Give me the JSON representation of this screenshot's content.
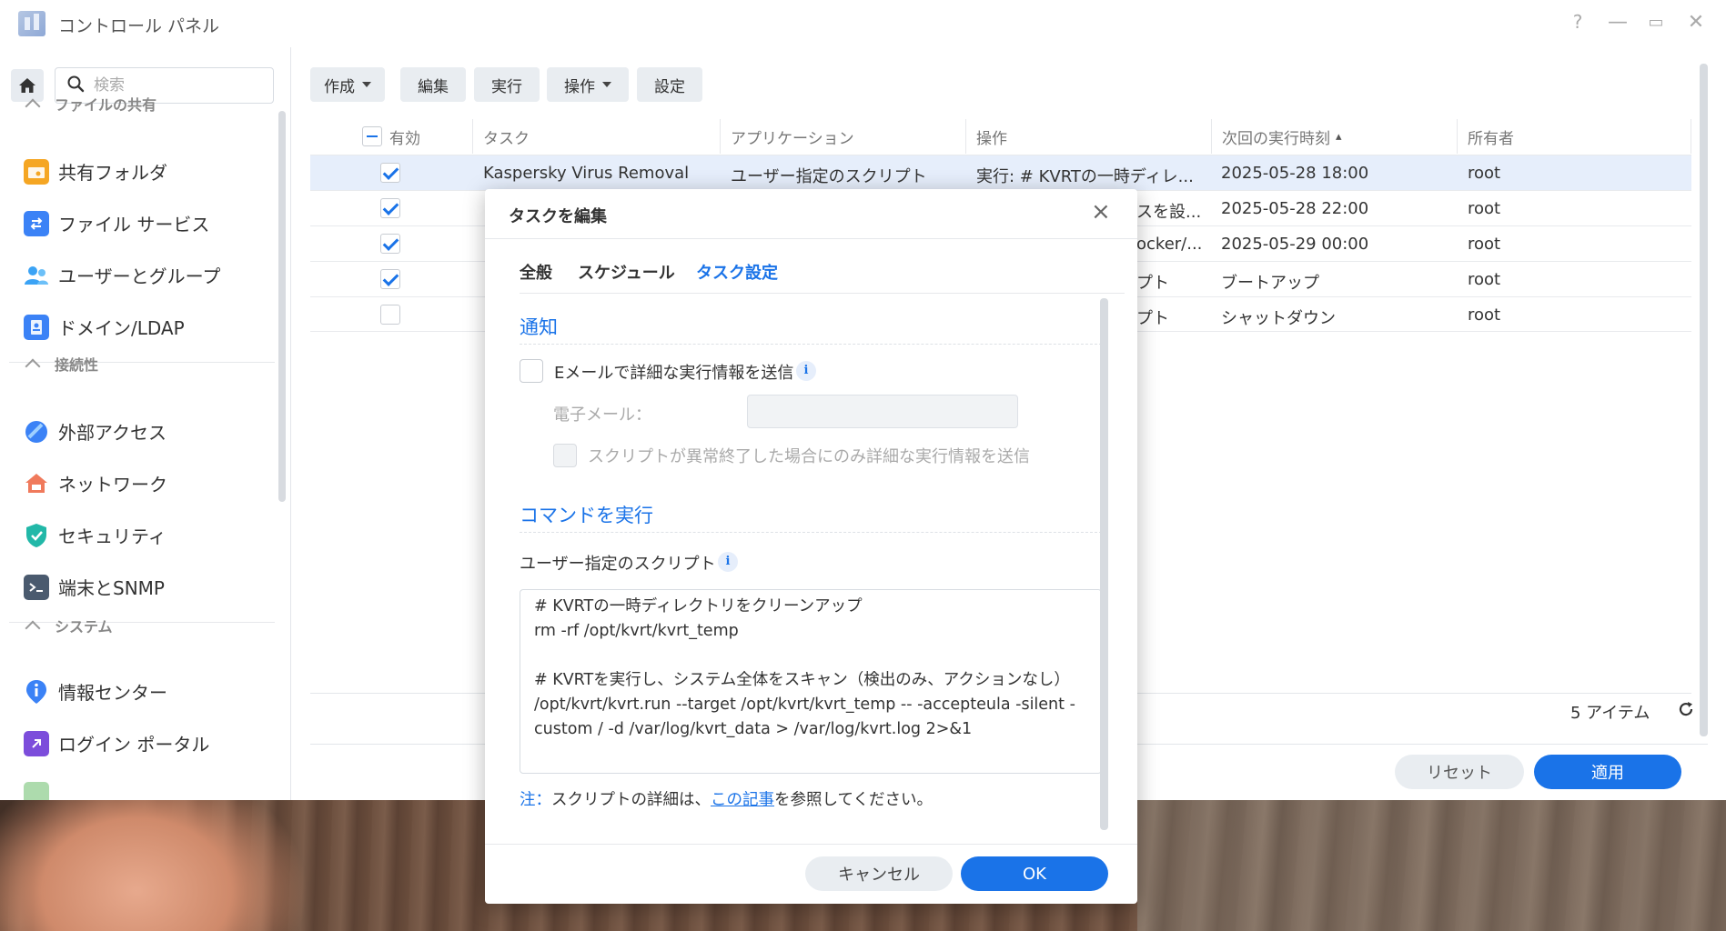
{
  "window": {
    "title": "コントロール パネル",
    "controls": {
      "help": "?",
      "minimize": "—",
      "maximize": "▭",
      "close": "✕"
    }
  },
  "sidebar": {
    "search_placeholder": "検索",
    "sections": [
      {
        "title": "ファイルの共有",
        "items": [
          {
            "label": "共有フォルダ",
            "icon": "shared-folder-icon",
            "color": "#f5a623"
          },
          {
            "label": "ファイル サービス",
            "icon": "file-services-icon",
            "color": "#3b82f6"
          },
          {
            "label": "ユーザーとグループ",
            "icon": "users-icon",
            "color": "#3ba3f5"
          },
          {
            "label": "ドメイン/LDAP",
            "icon": "domain-icon",
            "color": "#3b82f6"
          }
        ]
      },
      {
        "title": "接続性",
        "items": [
          {
            "label": "外部アクセス",
            "icon": "external-access-icon",
            "color": "#3b82f6"
          },
          {
            "label": "ネットワーク",
            "icon": "network-icon",
            "color": "#f07a5c"
          },
          {
            "label": "セキュリティ",
            "icon": "security-icon",
            "color": "#22b8a8"
          },
          {
            "label": "端末とSNMP",
            "icon": "terminal-icon",
            "color": "#4a5a6e"
          }
        ]
      },
      {
        "title": "システム",
        "items": [
          {
            "label": "情報センター",
            "icon": "info-center-icon",
            "color": "#3b82f6"
          },
          {
            "label": "ログイン ポータル",
            "icon": "login-portal-icon",
            "color": "#7c4ddb"
          }
        ]
      }
    ]
  },
  "toolbar": {
    "create": "作成",
    "edit": "編集",
    "run": "実行",
    "action": "操作",
    "settings": "設定"
  },
  "table": {
    "columns": [
      "有効",
      "タスク",
      "アプリケーション",
      "操作",
      "次回の実行時刻",
      "所有者"
    ],
    "sort_indicator": "▴",
    "rows": [
      {
        "enabled": true,
        "task": "Kaspersky Virus Removal",
        "app": "ユーザー指定のスクリプト",
        "op": "実行: # KVRTの一時ディレ...",
        "next": "2025-05-28 18:00",
        "owner": "root",
        "selected": true
      },
      {
        "enabled": true,
        "task": "",
        "app": "",
        "op": "スを設...",
        "next": "2025-05-28 22:00",
        "owner": "root"
      },
      {
        "enabled": true,
        "task": "",
        "app": "",
        "op": "ocker/...",
        "next": "2025-05-29 00:00",
        "owner": "root"
      },
      {
        "enabled": true,
        "task": "",
        "app": "",
        "op": "プト",
        "next": "ブートアップ",
        "owner": "root"
      },
      {
        "enabled": false,
        "task": "",
        "app": "",
        "op": "プト",
        "next": "シャットダウン",
        "owner": "root"
      }
    ],
    "item_count": "5 アイテム"
  },
  "footer": {
    "reset": "リセット",
    "apply": "適用"
  },
  "dialog": {
    "title": "タスクを編集",
    "tabs": [
      "全般",
      "スケジュール",
      "タスク設定"
    ],
    "active_tab": "タスク設定",
    "notify_section": "通知",
    "email_checkbox_label": "Eメールで詳細な実行情報を送信",
    "email_label": "電子メール：",
    "email_value": "",
    "abnormal_only_label": "スクリプトが異常終了した場合にのみ詳細な実行情報を送信",
    "command_section": "コマンドを実行",
    "script_label": "ユーザー指定のスクリプト",
    "script": "# KVRTの一時ディレクトリをクリーンアップ\nrm -rf /opt/kvrt/kvrt_temp\n\n# KVRTを実行し、システム全体をスキャン（検出のみ、アクションなし）\n/opt/kvrt/kvrt.run --target /opt/kvrt/kvrt_temp -- -accepteula -silent -custom / -d /var/log/kvrt_data > /var/log/kvrt.log 2>&1",
    "note_prefix": "注：",
    "note_text_1": "スクリプトの詳細は、",
    "note_link": "この記事",
    "note_text_2": "を参照してください。",
    "cancel": "キャンセル",
    "ok": "OK"
  },
  "colors": {
    "accent": "#1a73e8",
    "selected_row": "#e6eefb"
  }
}
